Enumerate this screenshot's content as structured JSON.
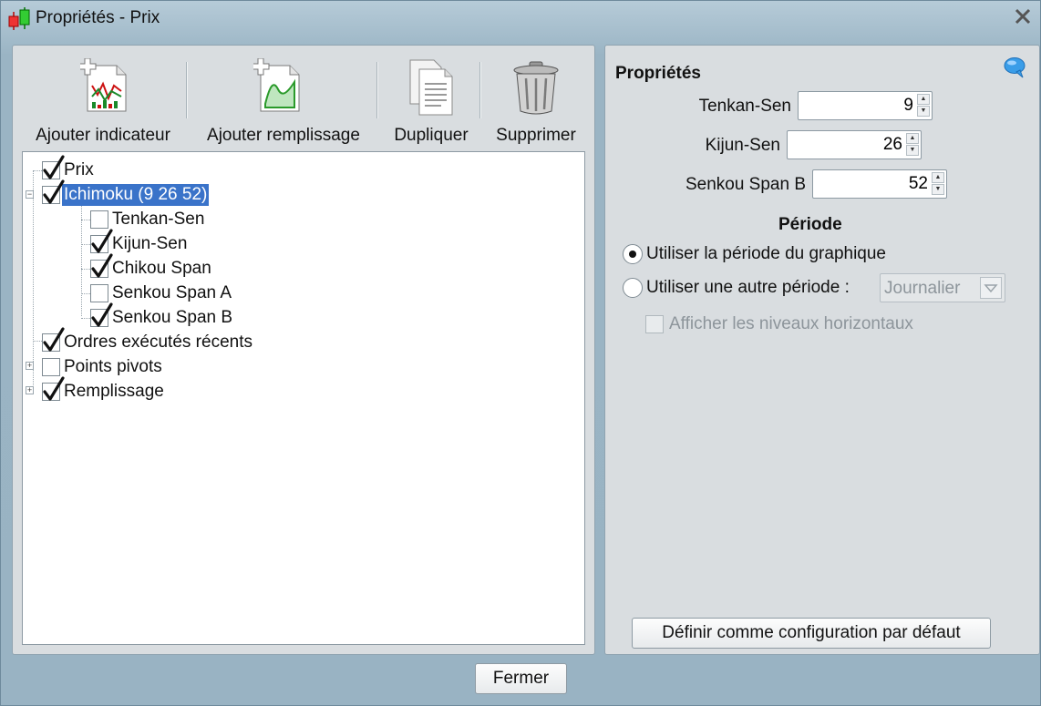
{
  "window": {
    "title": "Propriétés - Prix"
  },
  "toolbar": {
    "add_indicator": "Ajouter indicateur",
    "add_fill": "Ajouter remplissage",
    "duplicate": "Dupliquer",
    "delete": "Supprimer"
  },
  "tree": {
    "items": [
      {
        "label": "Prix",
        "checked": true,
        "level": 0
      },
      {
        "label": "Ichimoku (9 26 52)",
        "checked": true,
        "level": 0,
        "expanded": true,
        "selected": true
      },
      {
        "label": "Tenkan-Sen",
        "checked": false,
        "level": 1
      },
      {
        "label": "Kijun-Sen",
        "checked": true,
        "level": 1
      },
      {
        "label": "Chikou Span",
        "checked": true,
        "level": 1
      },
      {
        "label": "Senkou Span A",
        "checked": false,
        "level": 1
      },
      {
        "label": "Senkou Span B",
        "checked": true,
        "level": 1
      },
      {
        "label": "Ordres exécutés récents",
        "checked": true,
        "level": 0
      },
      {
        "label": "Points pivots",
        "checked": false,
        "level": 0,
        "expanded": false
      },
      {
        "label": "Remplissage",
        "checked": true,
        "level": 0,
        "expanded": false
      }
    ]
  },
  "properties": {
    "title": "Propriétés",
    "fields": [
      {
        "label": "Tenkan-Sen",
        "value": "9"
      },
      {
        "label": "Kijun-Sen",
        "value": "26"
      },
      {
        "label": "Senkou Span B",
        "value": "52"
      }
    ]
  },
  "period": {
    "title": "Période",
    "use_chart_period": "Utiliser la période du graphique",
    "use_other_period": "Utiliser une autre période :",
    "selected": "chart",
    "other_period_value": "Journalier",
    "show_horizontal_levels": "Afficher les niveaux horizontaux"
  },
  "buttons": {
    "set_default": "Définir comme configuration par défaut",
    "close": "Fermer"
  }
}
